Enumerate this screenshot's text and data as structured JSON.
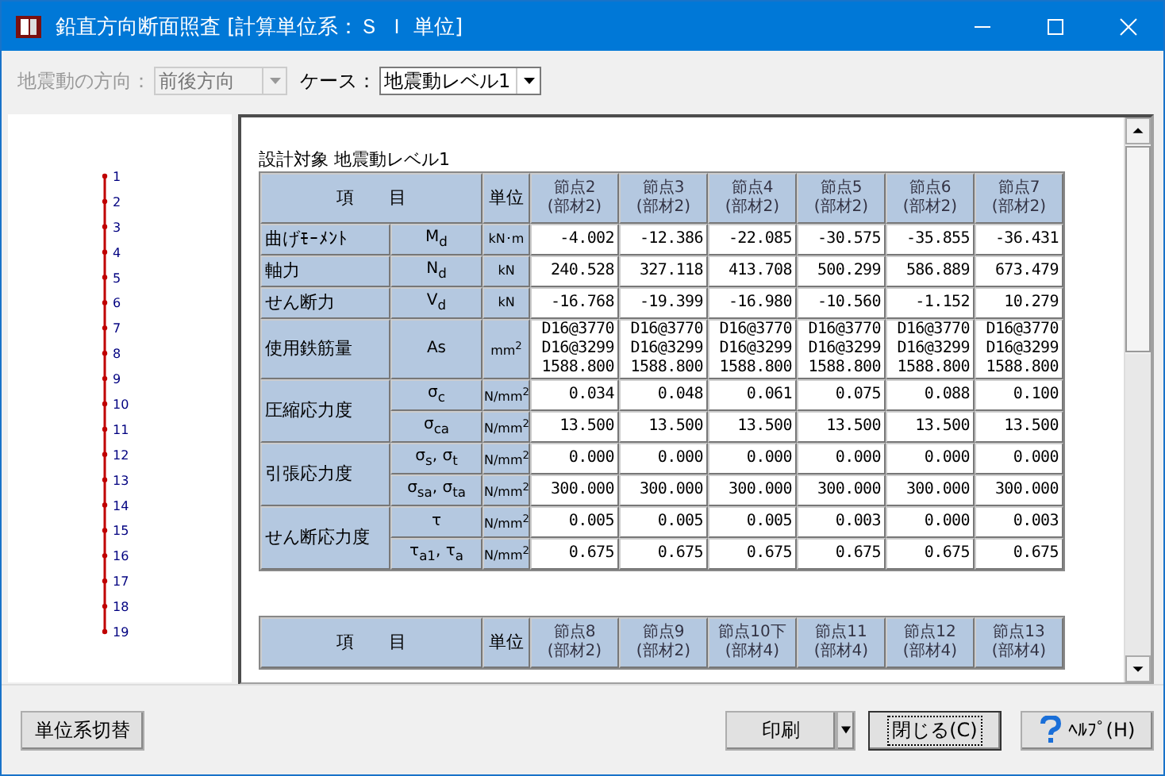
{
  "window": {
    "title": "鉛直方向断面照査 [計算単位系：Ｓ Ｉ 単位]"
  },
  "toolbar": {
    "direction": {
      "label": "地震動の方向：",
      "value": "前後方向",
      "disabled": true
    },
    "case": {
      "label": "ケース：",
      "value": "地震動レベル1",
      "disabled": false
    }
  },
  "diagram": {
    "nodes": [
      "1",
      "2",
      "3",
      "4",
      "5",
      "6",
      "7",
      "8",
      "9",
      "10",
      "11",
      "12",
      "13",
      "14",
      "15",
      "16",
      "17",
      "18",
      "19"
    ]
  },
  "report": {
    "title": "設計対象  地震動レベル1",
    "tables": [
      {
        "item_header": "項　　目",
        "unit_header": "単位",
        "columns": [
          {
            "node": "節点2",
            "member": "(部材2)"
          },
          {
            "node": "節点3",
            "member": "(部材2)"
          },
          {
            "node": "節点4",
            "member": "(部材2)"
          },
          {
            "node": "節点5",
            "member": "(部材2)"
          },
          {
            "node": "節点6",
            "member": "(部材2)"
          },
          {
            "node": "節点7",
            "member": "(部材2)"
          }
        ],
        "groups": [
          {
            "item": "曲げﾓｰﾒﾝﾄ",
            "rows": [
              {
                "symbol": "M$_{d}$",
                "unit": "kN･m",
                "values": [
                  "-4.002",
                  "-12.386",
                  "-22.085",
                  "-30.575",
                  "-35.855",
                  "-36.431"
                ]
              }
            ]
          },
          {
            "item": "軸力",
            "rows": [
              {
                "symbol": "N$_{d}$",
                "unit": "kN",
                "values": [
                  "240.528",
                  "327.118",
                  "413.708",
                  "500.299",
                  "586.889",
                  "673.479"
                ]
              }
            ]
          },
          {
            "item": "せん断力",
            "rows": [
              {
                "symbol": "V$_{d}$",
                "unit": "kN",
                "values": [
                  "-16.768",
                  "-19.399",
                  "-16.980",
                  "-10.560",
                  "-1.152",
                  "10.279"
                ]
              }
            ]
          },
          {
            "item": "使用鉄筋量",
            "rows": [
              {
                "symbol": "As",
                "unit": "mm$^{2}$",
                "values": [
                  "D16@3770\nD16@3299\n1588.800",
                  "D16@3770\nD16@3299\n1588.800",
                  "D16@3770\nD16@3299\n1588.800",
                  "D16@3770\nD16@3299\n1588.800",
                  "D16@3770\nD16@3299\n1588.800",
                  "D16@3770\nD16@3299\n1588.800"
                ]
              }
            ]
          },
          {
            "item": "圧縮応力度",
            "rows": [
              {
                "symbol": "σ$_{c}$",
                "unit": "N/mm$^{2}$",
                "values": [
                  "0.034",
                  "0.048",
                  "0.061",
                  "0.075",
                  "0.088",
                  "0.100"
                ]
              },
              {
                "symbol": "σ$_{ca}$",
                "unit": "N/mm$^{2}$",
                "values": [
                  "13.500",
                  "13.500",
                  "13.500",
                  "13.500",
                  "13.500",
                  "13.500"
                ]
              }
            ]
          },
          {
            "item": "引張応力度",
            "rows": [
              {
                "symbol": "σ$_{s}$, σ$_{t}$",
                "unit": "N/mm$^{2}$",
                "values": [
                  "0.000",
                  "0.000",
                  "0.000",
                  "0.000",
                  "0.000",
                  "0.000"
                ]
              },
              {
                "symbol": "σ$_{sa}$, σ$_{ta}$",
                "unit": "N/mm$^{2}$",
                "values": [
                  "300.000",
                  "300.000",
                  "300.000",
                  "300.000",
                  "300.000",
                  "300.000"
                ]
              }
            ]
          },
          {
            "item": "せん断応力度",
            "rows": [
              {
                "symbol": "τ",
                "unit": "N/mm$^{2}$",
                "values": [
                  "0.005",
                  "0.005",
                  "0.005",
                  "0.003",
                  "0.000",
                  "0.003"
                ]
              },
              {
                "symbol": "τ$_{a1}$, τ$_{a}$",
                "unit": "N/mm$^{2}$",
                "values": [
                  "0.675",
                  "0.675",
                  "0.675",
                  "0.675",
                  "0.675",
                  "0.675"
                ]
              }
            ]
          }
        ]
      },
      {
        "item_header": "項　　目",
        "unit_header": "単位",
        "columns": [
          {
            "node": "節点8",
            "member": "(部材2)"
          },
          {
            "node": "節点9",
            "member": "(部材2)"
          },
          {
            "node": "節点10下",
            "member": "(部材4)"
          },
          {
            "node": "節点11",
            "member": "(部材4)"
          },
          {
            "node": "節点12",
            "member": "(部材4)"
          },
          {
            "node": "節点13",
            "member": "(部材4)"
          }
        ]
      }
    ]
  },
  "buttons": {
    "left": [
      {
        "label": "単位系切替",
        "kind": "plain"
      }
    ],
    "right": [
      {
        "label": "印刷",
        "kind": "split"
      },
      {
        "label": "閉じる(C)",
        "kind": "default"
      },
      {
        "label": "ﾍﾙﾌﾟ(H)",
        "kind": "help"
      }
    ]
  }
}
